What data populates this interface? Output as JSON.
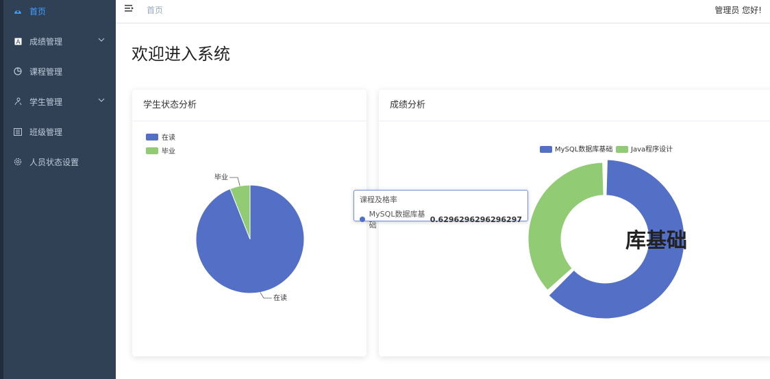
{
  "sidebar": {
    "items": [
      {
        "label": "首页",
        "icon": "dashboard-icon",
        "active": true
      },
      {
        "label": "成绩管理",
        "icon": "grade-icon",
        "expandable": true
      },
      {
        "label": "课程管理",
        "icon": "clock-icon"
      },
      {
        "label": "学生管理",
        "icon": "student-icon",
        "expandable": true
      },
      {
        "label": "班级管理",
        "icon": "class-icon"
      },
      {
        "label": "人员状态设置",
        "icon": "gear-icon"
      }
    ]
  },
  "header": {
    "breadcrumb": "首页",
    "user_greeting": "管理员 您好!"
  },
  "main": {
    "title": "欢迎进入系统"
  },
  "charts": {
    "student_status": {
      "title": "学生状态分析"
    },
    "grades": {
      "title": "成绩分析"
    }
  },
  "chart_data": [
    {
      "type": "pie",
      "title": "学生状态分析",
      "legend": [
        "在读",
        "毕业"
      ],
      "labels": [
        "在读",
        "毕业"
      ],
      "values": [
        0.94,
        0.06
      ],
      "colors": [
        "#5470c6",
        "#91cc75"
      ],
      "legend_position": "top-left"
    },
    {
      "type": "pie",
      "subtype": "donut",
      "title": "成绩分析",
      "legend": [
        "MySQL数据库基础",
        "Java程序设计"
      ],
      "labels": [
        "MySQL数据库基础",
        "Java程序设计"
      ],
      "values": [
        0.6296296296296297,
        0.3703703703703703
      ],
      "colors": [
        "#5470c6",
        "#91cc75"
      ],
      "legend_position": "top-center",
      "tooltip": {
        "title": "课程及格率",
        "series": "MySQL数据库基础",
        "value": "0.6296296296296297"
      },
      "center_label": "库基础"
    }
  ]
}
